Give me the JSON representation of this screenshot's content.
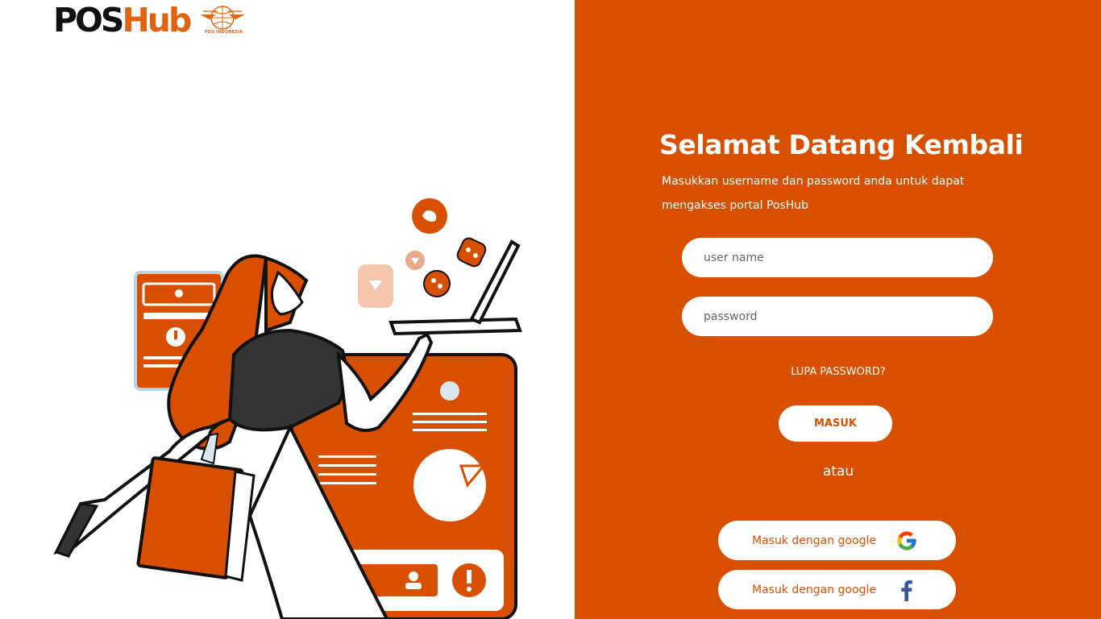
{
  "brand": {
    "logo_pos": "POS",
    "logo_hub": "Hub",
    "partner_label": "POS INDONESIA",
    "accent_color": "#d94f00"
  },
  "login": {
    "title": "Selamat Datang Kembali",
    "subtitle": "Masukkan username dan password anda untuk dapat mengakses portal PosHub",
    "username_placeholder": "user name",
    "username_value": "",
    "password_placeholder": "password",
    "password_value": "",
    "forgot_label": "LUPA PASSWORD?",
    "submit_label": "MASUK",
    "divider_label": "atau",
    "google_label": "Masuk dengan google",
    "facebook_label": "Masuk dengan google",
    "google_icon": "google-icon",
    "facebook_icon": "facebook-icon"
  }
}
